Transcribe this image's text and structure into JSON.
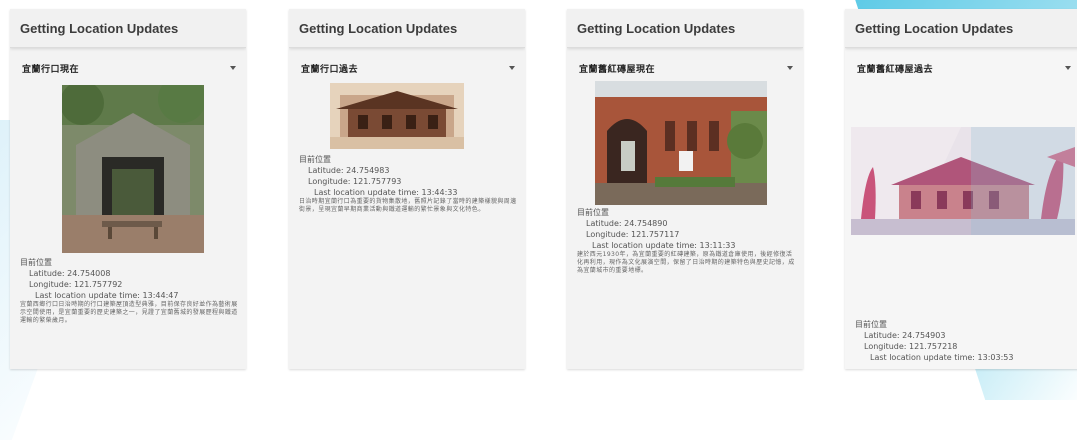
{
  "screens": [
    {
      "app_title": "Getting Location Updates",
      "selector_value": "宜蘭行口現在",
      "status_label": "目前位置",
      "latitude": "Latitude: 24.754008",
      "longitude": "Longitude: 121.757792",
      "update_time": "Last location update time: 13:44:47",
      "description": "宜蘭西鄉行口日治時期的行口建築屋頂造型典雅，目前保存良好並作為藝術展示空間使用，是宜蘭重要的歷史建築之一，見證了宜蘭舊城的發展歷程與鐵道運輸的繁榮歲月。"
    },
    {
      "app_title": "Getting Location Updates",
      "selector_value": "宜蘭行口過去",
      "status_label": "目前位置",
      "latitude": "Latitude: 24.754983",
      "longitude": "Longitude: 121.757793",
      "update_time": "Last location update time: 13:44:33",
      "description": "日治時期宜蘭行口為重要的貨物集散地，舊照片記錄了當時的建築樣貌與周邊街景，呈現宜蘭早期商業活動與鐵道運輸的繁忙景象與文化特色。"
    },
    {
      "app_title": "Getting Location Updates",
      "selector_value": "宜蘭舊紅磚屋現在",
      "status_label": "目前位置",
      "latitude": "Latitude: 24.754890",
      "longitude": "Longitude: 121.757117",
      "update_time": "Last location update time: 13:11:33",
      "description": "建於西元1930年，為宜蘭重要的紅磚建築，原為鐵道倉庫使用，後經修復活化再利用，現作為文化展演空間，保留了日治時期的建築特色與歷史記憶，成為宜蘭城市的重要地標。"
    },
    {
      "app_title": "Getting Location Updates",
      "selector_value": "宜蘭舊紅磚屋過去",
      "status_label": "目前位置",
      "latitude": "Latitude: 24.754903",
      "longitude": "Longitude: 121.757218",
      "update_time": "Last location update time: 13:03:53",
      "description": ""
    }
  ],
  "icons": {
    "dropdown": "chevron-down-icon"
  },
  "colors": {
    "accent_stripe": "#1ab4dc",
    "appbar": "#f1f1f1",
    "panel": "#f3f3f3"
  }
}
